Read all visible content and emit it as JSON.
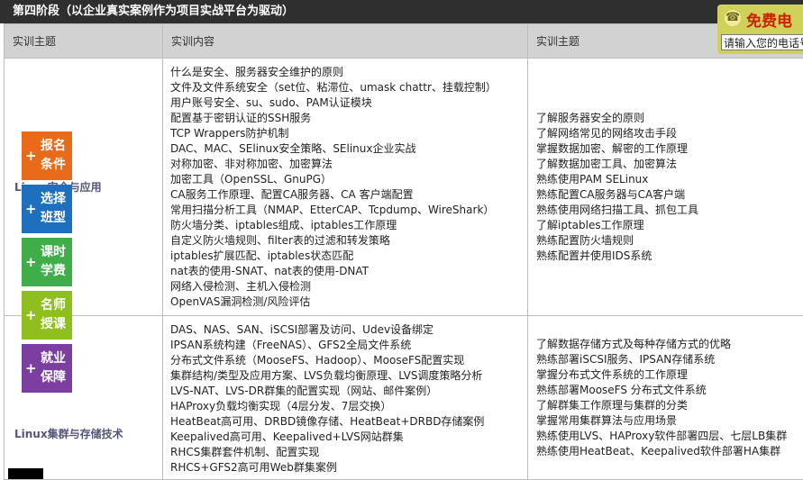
{
  "header": {
    "title": "第四阶段（以企业真实案例作为项目实战平台为驱动）"
  },
  "table": {
    "columns": [
      "实训主题",
      "实训内容",
      "实训主题"
    ],
    "rows": [
      {
        "topic": "Linux安全与应用",
        "content": [
          "什么是安全、服务器安全维护的原则",
          "文件及文件系统安全（set位、粘滞位、umask chattr、挂载控制）",
          "用户账号安全、su、sudo、PAM认证模块",
          "配置基于密钥认证的SSH服务",
          "TCP Wrappers防护机制",
          "DAC、MAC、SElinux安全策略、SElinux企业实战",
          "对称加密、非对称加密、加密算法",
          "加密工具（OpenSSL、GnuPG）",
          "CA服务工作原理、配置CA服务器、CA 客户端配置",
          "常用扫描分析工具（NMAP、EtterCAP、Tcpdump、WireShark）",
          "防火墙分类、iptables组成、iptables工作原理",
          "自定义防火墙规则、filter表的过滤和转发策略",
          "iptables扩展匹配、iptables状态匹配",
          "nat表的使用-SNAT、nat表的使用-DNAT",
          "网络入侵检测、主机入侵检测",
          "OpenVAS漏洞检测/风险评估"
        ],
        "goals": [
          "了解服务器安全的原则",
          "了解网络常见的网络攻击手段",
          "掌握数据加密、解密的工作原理",
          "了解数据加密工具、加密算法",
          "熟练使用PAM SELinux",
          "熟练配置CA服务器与CA客户端",
          "熟练使用网络扫描工具、抓包工具",
          "了解iptables工作原理",
          "熟练配置防火墙规则",
          "熟练配置并使用IDS系统"
        ]
      },
      {
        "topic": "Linux集群与存储技术",
        "content": [
          "DAS、NAS、SAN、iSCSI部署及访问、Udev设备绑定",
          "IPSAN系统构建（FreeNAS）、GFS2全局文件系统",
          "分布式文件系统（MooseFS、Hadoop）、MooseFS配置实现",
          "集群结构/类型及应用方案、LVS负载均衡原理、LVS调度策略分析",
          "LVS-NAT、LVS-DR群集的配置实现（网站、邮件案例）",
          "HAProxy负载均衡实现（4层分发、7层交换）",
          "HeatBeat高可用、DRBD镜像存储、HeatBeat+DRBD存储案例",
          "Keepalived高可用、Keepalived+LVS网站群集",
          "RHCS集群套件机制、配置实现",
          "RHCS+GFS2高可用Web群集案例"
        ],
        "goals": [
          "了解数据存储方式及每种存储方式的优略",
          "熟练部署iSCSI服务、IPSAN存储系统",
          "掌握分布式文件系统的工作原理",
          "熟练部署MooseFS 分布式文件系统",
          "了解群集工作原理与集群的分类",
          "掌握常用集群算法与应用场景",
          "熟练使用LVS、HAProxy软件部署四层、七层LB集群",
          "熟练使用HeatBeat、Keepalived软件部署HA集群"
        ]
      }
    ]
  },
  "side_menu": [
    {
      "plus": "+",
      "label": "报名条件",
      "color": "#e96a19"
    },
    {
      "plus": "+",
      "label": "选择班型",
      "color": "#1f6fbf"
    },
    {
      "plus": "+",
      "label": "课时学费",
      "color": "#3fae49"
    },
    {
      "plus": "+",
      "label": "名师授课",
      "color": "#8fbf1e"
    },
    {
      "plus": "+",
      "label": "就业保障",
      "color": "#7b3fa0"
    }
  ],
  "free_call": {
    "title": "免费电",
    "input_value": "请输入您的电话号",
    "phone_icon": "phone-icon"
  }
}
